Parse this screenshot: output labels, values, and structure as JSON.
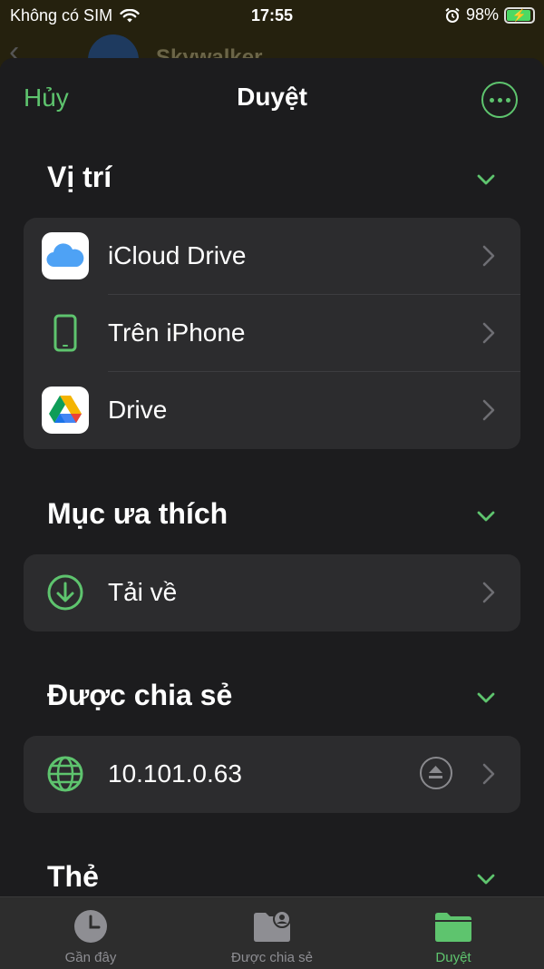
{
  "status_bar": {
    "carrier": "Không có SIM",
    "time": "17:55",
    "battery": "98%"
  },
  "background_app": {
    "contact_name": "Skywalker"
  },
  "nav": {
    "cancel": "Hủy",
    "title": "Duyệt"
  },
  "sections": {
    "locations": {
      "title": "Vị trí",
      "items": [
        {
          "label": "iCloud Drive"
        },
        {
          "label": "Trên iPhone"
        },
        {
          "label": "Drive"
        }
      ]
    },
    "favorites": {
      "title": "Mục ưa thích",
      "items": [
        {
          "label": "Tải về"
        }
      ]
    },
    "shared": {
      "title": "Được chia sẻ",
      "items": [
        {
          "label": "10.101.0.63"
        }
      ]
    },
    "tags": {
      "title": "Thẻ"
    }
  },
  "tabbar": {
    "tabs": [
      {
        "label": "Gần đây"
      },
      {
        "label": "Được chia sẻ"
      },
      {
        "label": "Duyệt"
      }
    ],
    "active": "Duyệt"
  },
  "colors": {
    "accent": "#5ec46e",
    "background": "#1c1c1e",
    "row_background": "#2c2c2e",
    "tabbar": "#2d2d2d"
  }
}
